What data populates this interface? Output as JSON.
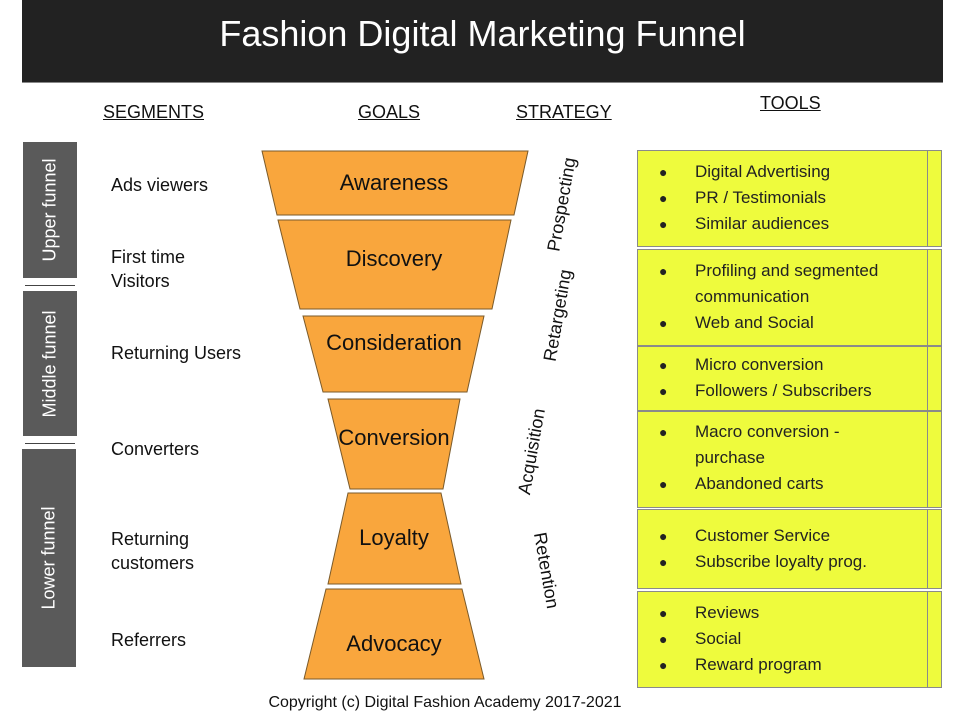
{
  "title": "Fashion Digital Marketing Funnel",
  "headers": {
    "segments": "SEGMENTS",
    "goals": "GOALS",
    "strategy": "STRATEGY",
    "tools": "TOOLS"
  },
  "funnel_stages": [
    {
      "label": "Upper funnel"
    },
    {
      "label": "Middle funnel"
    },
    {
      "label": "Lower funnel"
    }
  ],
  "segments": [
    {
      "line1": "Ads viewers",
      "line2": ""
    },
    {
      "line1": "First time",
      "line2": "Visitors"
    },
    {
      "line1": "Returning Users",
      "line2": ""
    },
    {
      "line1": "Converters",
      "line2": ""
    },
    {
      "line1": "Returning",
      "line2": "customers"
    },
    {
      "line1": "Referrers",
      "line2": ""
    }
  ],
  "goals": [
    {
      "label": "Awareness"
    },
    {
      "label": "Discovery"
    },
    {
      "label": "Consideration"
    },
    {
      "label": "Conversion"
    },
    {
      "label": "Loyalty"
    },
    {
      "label": "Advocacy"
    }
  ],
  "strategies": [
    {
      "label": "Prospecting"
    },
    {
      "label": "Retargeting"
    },
    {
      "label": "Acquisition"
    },
    {
      "label": "Retention"
    }
  ],
  "tools": [
    {
      "items": [
        "Digital Advertising",
        "PR / Testimonials",
        "Similar audiences"
      ]
    },
    {
      "items": [
        "Profiling and segmented",
        "communication",
        "Web and Social"
      ],
      "bullets": [
        true,
        false,
        true
      ]
    },
    {
      "items": [
        "Micro conversion",
        "Followers / Subscribers"
      ]
    },
    {
      "items": [
        "Macro conversion -",
        "purchase",
        "Abandoned carts"
      ],
      "bullets": [
        true,
        false,
        true
      ]
    },
    {
      "items": [
        "Customer Service",
        "Subscribe loyalty prog."
      ]
    },
    {
      "items": [
        "Reviews",
        "Social",
        "Reward program"
      ]
    }
  ],
  "bullet_glyph": "●",
  "colors": {
    "title_bar": "#222222",
    "stage_bar": "#5a5a5a",
    "funnel_fill": "#f9a63d",
    "funnel_stroke": "#7a5a2a",
    "tools_fill": "#eefb3d"
  },
  "footer": "Copyright (c) Digital Fashion Academy 2017-2021"
}
